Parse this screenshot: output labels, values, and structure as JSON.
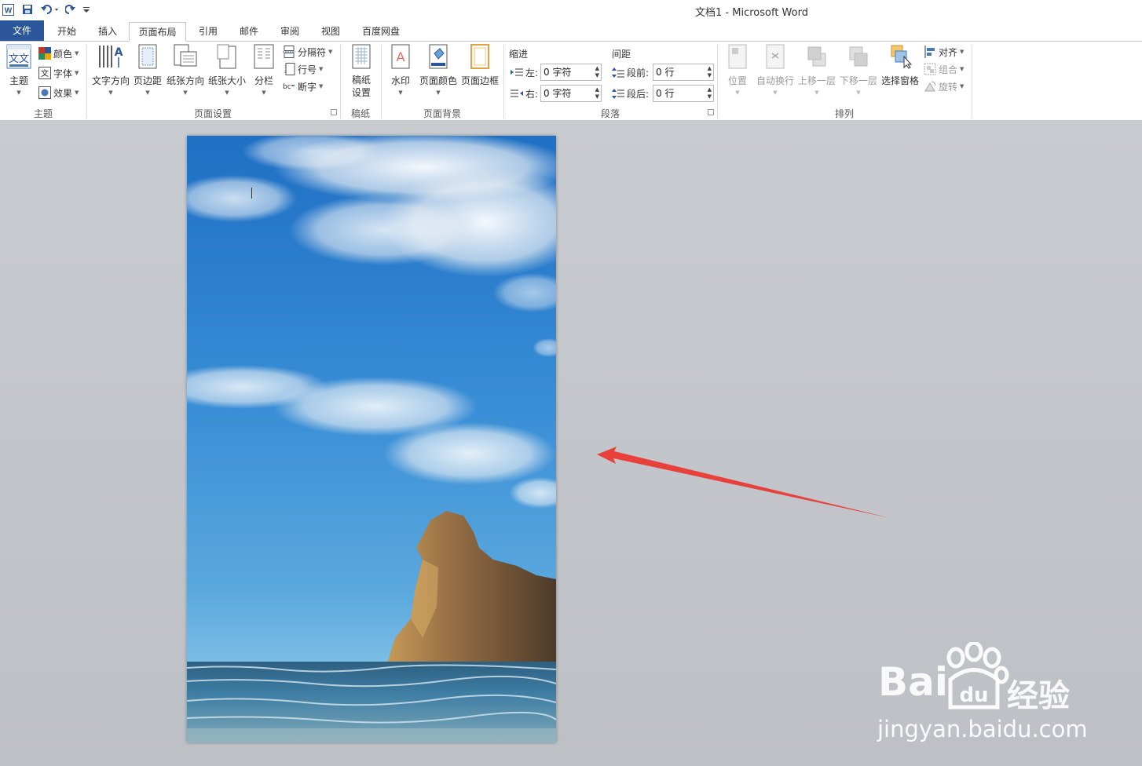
{
  "window": {
    "title": "文档1  -  Microsoft Word"
  },
  "tabs": [
    {
      "label": "文件",
      "state": "file"
    },
    {
      "label": "开始"
    },
    {
      "label": "插入"
    },
    {
      "label": "页面布局",
      "state": "active"
    },
    {
      "label": "引用"
    },
    {
      "label": "邮件"
    },
    {
      "label": "审阅"
    },
    {
      "label": "视图"
    },
    {
      "label": "百度网盘"
    }
  ],
  "ribbon": {
    "theme": {
      "label": "主题",
      "theme_btn": "主题",
      "colors": "颜色",
      "fonts": "字体",
      "effects": "效果"
    },
    "page_setup": {
      "label": "页面设置",
      "text_direction": "文字方向",
      "margins": "页边距",
      "orientation": "纸张方向",
      "size": "纸张大小",
      "columns": "分栏",
      "breaks": "分隔符",
      "line_numbers": "行号",
      "hyphenation": "断字"
    },
    "manuscript": {
      "label": "稿纸",
      "setup_line1": "稿纸",
      "setup_line2": "设置"
    },
    "page_background": {
      "label": "页面背景",
      "watermark": "水印",
      "page_color": "页面颜色",
      "page_borders": "页面边框"
    },
    "paragraph": {
      "label": "段落",
      "indent_header": "缩进",
      "spacing_header": "间距",
      "left_label": "左:",
      "right_label": "右:",
      "before_label": "段前:",
      "after_label": "段后:",
      "left_value": "0 字符",
      "right_value": "0 字符",
      "before_value": "0 行",
      "after_value": "0 行"
    },
    "arrange": {
      "label": "排列",
      "position": "位置",
      "wrap_text": "自动换行",
      "bring_forward": "上移一层",
      "send_backward": "下移一层",
      "selection_pane": "选择窗格",
      "align": "对齐",
      "group": "组合",
      "rotate": "旋转"
    }
  },
  "watermark_overlay": {
    "logo": "Bai",
    "logo_cn": "经验",
    "url": "jingyan.baidu.com"
  },
  "colors": {
    "file_tab": "#2b579a",
    "annotation_arrow": "#e8413c"
  }
}
